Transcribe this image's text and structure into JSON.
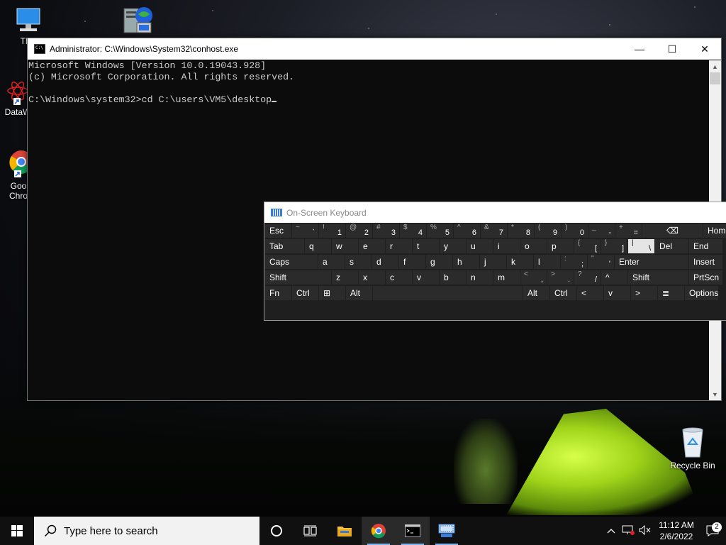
{
  "desktop": {
    "icons": [
      {
        "label": "This"
      },
      {
        "label": ""
      },
      {
        "label": "DataW"
      },
      {
        "label": "Goo Chro"
      },
      {
        "label": "Recycle Bin"
      }
    ]
  },
  "console": {
    "title": "Administrator: C:\\Windows\\System32\\conhost.exe",
    "lines": [
      "Microsoft Windows [Version 10.0.19043.928]",
      "(c) Microsoft Corporation. All rights reserved.",
      "",
      "C:\\Windows\\system32>cd C:\\users\\VM5\\desktop"
    ],
    "controls": {
      "minimize": "—",
      "maximize": "☐",
      "close": "✕"
    }
  },
  "osk": {
    "title": "On-Screen Keyboard",
    "rows": [
      [
        {
          "main": "Esc",
          "w": 38
        },
        {
          "shift": "~",
          "lower": "`",
          "w": 38
        },
        {
          "shift": "!",
          "lower": "1",
          "w": 38
        },
        {
          "shift": "@",
          "lower": "2",
          "w": 38
        },
        {
          "shift": "#",
          "lower": "3",
          "w": 38
        },
        {
          "shift": "$",
          "lower": "4",
          "w": 38
        },
        {
          "shift": "%",
          "lower": "5",
          "w": 38
        },
        {
          "shift": "^",
          "lower": "6",
          "w": 38
        },
        {
          "shift": "&",
          "lower": "7",
          "w": 38
        },
        {
          "shift": "*",
          "lower": "8",
          "w": 38
        },
        {
          "shift": "(",
          "lower": "9",
          "w": 38
        },
        {
          "shift": ")",
          "lower": "0",
          "w": 38
        },
        {
          "shift": "_",
          "lower": "-",
          "w": 38
        },
        {
          "shift": "+",
          "lower": "=",
          "w": 38
        },
        {
          "main": "⌫",
          "w": 86,
          "center": true
        },
        {
          "main": "Home",
          "w": 48
        }
      ],
      [
        {
          "main": "Tab",
          "w": 56
        },
        {
          "main": "q",
          "w": 38
        },
        {
          "main": "w",
          "w": 38
        },
        {
          "main": "e",
          "w": 38
        },
        {
          "main": "r",
          "w": 38
        },
        {
          "main": "t",
          "w": 38
        },
        {
          "main": "y",
          "w": 38
        },
        {
          "main": "u",
          "w": 38
        },
        {
          "main": "i",
          "w": 38
        },
        {
          "main": "o",
          "w": 38
        },
        {
          "main": "p",
          "w": 38
        },
        {
          "shift": "{",
          "lower": "[",
          "w": 38
        },
        {
          "shift": "}",
          "lower": "]",
          "w": 38
        },
        {
          "shift": "|",
          "lower": "\\",
          "w": 38,
          "selected": true
        },
        {
          "main": "Del",
          "w": 48
        },
        {
          "main": "End",
          "w": 48
        }
      ],
      [
        {
          "main": "Caps",
          "w": 75
        },
        {
          "main": "a",
          "w": 38
        },
        {
          "main": "s",
          "w": 38
        },
        {
          "main": "d",
          "w": 38
        },
        {
          "main": "f",
          "w": 38
        },
        {
          "main": "g",
          "w": 38
        },
        {
          "main": "h",
          "w": 38
        },
        {
          "main": "j",
          "w": 38
        },
        {
          "main": "k",
          "w": 38
        },
        {
          "main": "l",
          "w": 38
        },
        {
          "shift": ":",
          "lower": ";",
          "w": 38
        },
        {
          "shift": "\"",
          "lower": "'",
          "w": 38
        },
        {
          "main": "Enter",
          "w": 105
        },
        {
          "main": "Insert",
          "w": 48
        }
      ],
      [
        {
          "main": "Shift",
          "w": 94
        },
        {
          "main": "z",
          "w": 38
        },
        {
          "main": "x",
          "w": 38
        },
        {
          "main": "c",
          "w": 38
        },
        {
          "main": "v",
          "w": 38
        },
        {
          "main": "b",
          "w": 38
        },
        {
          "main": "n",
          "w": 38
        },
        {
          "main": "m",
          "w": 38
        },
        {
          "shift": "<",
          "lower": ",",
          "w": 38
        },
        {
          "shift": ">",
          "lower": ".",
          "w": 38
        },
        {
          "shift": "?",
          "lower": "/",
          "w": 38
        },
        {
          "main": "^",
          "w": 38
        },
        {
          "main": "Shift",
          "w": 86
        },
        {
          "main": "PrtScn",
          "w": 48
        }
      ],
      [
        {
          "main": "Fn",
          "w": 38
        },
        {
          "main": "Ctrl",
          "w": 38
        },
        {
          "main": "⊞",
          "w": 38
        },
        {
          "main": "Alt",
          "w": 38
        },
        {
          "main": "",
          "w": 212
        },
        {
          "main": "Alt",
          "w": 38
        },
        {
          "main": "Ctrl",
          "w": 38
        },
        {
          "main": "<",
          "w": 38
        },
        {
          "main": "v",
          "w": 38
        },
        {
          "main": ">",
          "w": 38
        },
        {
          "main": "≣",
          "w": 38
        },
        {
          "main": "Options",
          "w": 48
        }
      ]
    ]
  },
  "taskbar": {
    "search_placeholder": "Type here to search",
    "clock_time": "11:12 AM",
    "clock_date": "2/6/2022",
    "notifications_count": "2"
  }
}
